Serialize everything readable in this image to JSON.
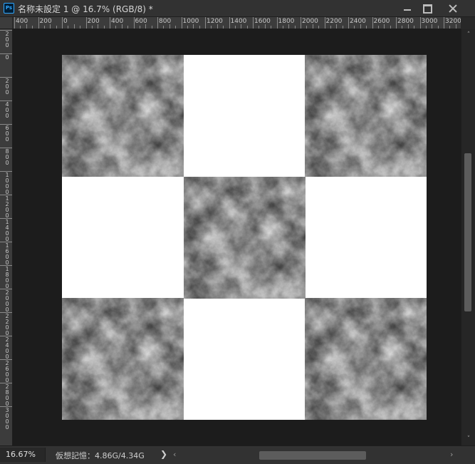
{
  "window": {
    "title": "名称未設定 1 @ 16.7% (RGB/8) *",
    "app_icon_text": "Ps",
    "minimize_label": "",
    "maximize_label": "",
    "close_label": ""
  },
  "ruler_top": {
    "labels": [
      "400",
      "200",
      "0",
      "200",
      "400",
      "600",
      "800",
      "1000",
      "1200",
      "1400",
      "1600",
      "1800",
      "2000",
      "2200",
      "2400",
      "2600",
      "2800",
      "3000",
      "3200"
    ]
  },
  "ruler_left": {
    "labels": [
      "200",
      "0",
      "200",
      "400",
      "600",
      "800",
      "1000",
      "1200",
      "1400",
      "1600",
      "1800",
      "2000",
      "2200",
      "2400",
      "2600",
      "2800",
      "3000"
    ]
  },
  "canvas": {
    "background_color": "#1c1c1c",
    "document_color": "#ffffff",
    "pattern": "checkerboard of clouds texture",
    "grid": [
      [
        "clouds",
        "white",
        "clouds"
      ],
      [
        "white",
        "clouds",
        "white"
      ],
      [
        "clouds",
        "white",
        "clouds"
      ]
    ]
  },
  "status": {
    "zoom": "16.67%",
    "memory": "仮想記憶：4.86G/4.34G",
    "arrow": "❯"
  },
  "scrollbar": {
    "left_arrow": "‹",
    "right_arrow": "›",
    "up_arrow": "˄",
    "down_arrow": "˅"
  }
}
